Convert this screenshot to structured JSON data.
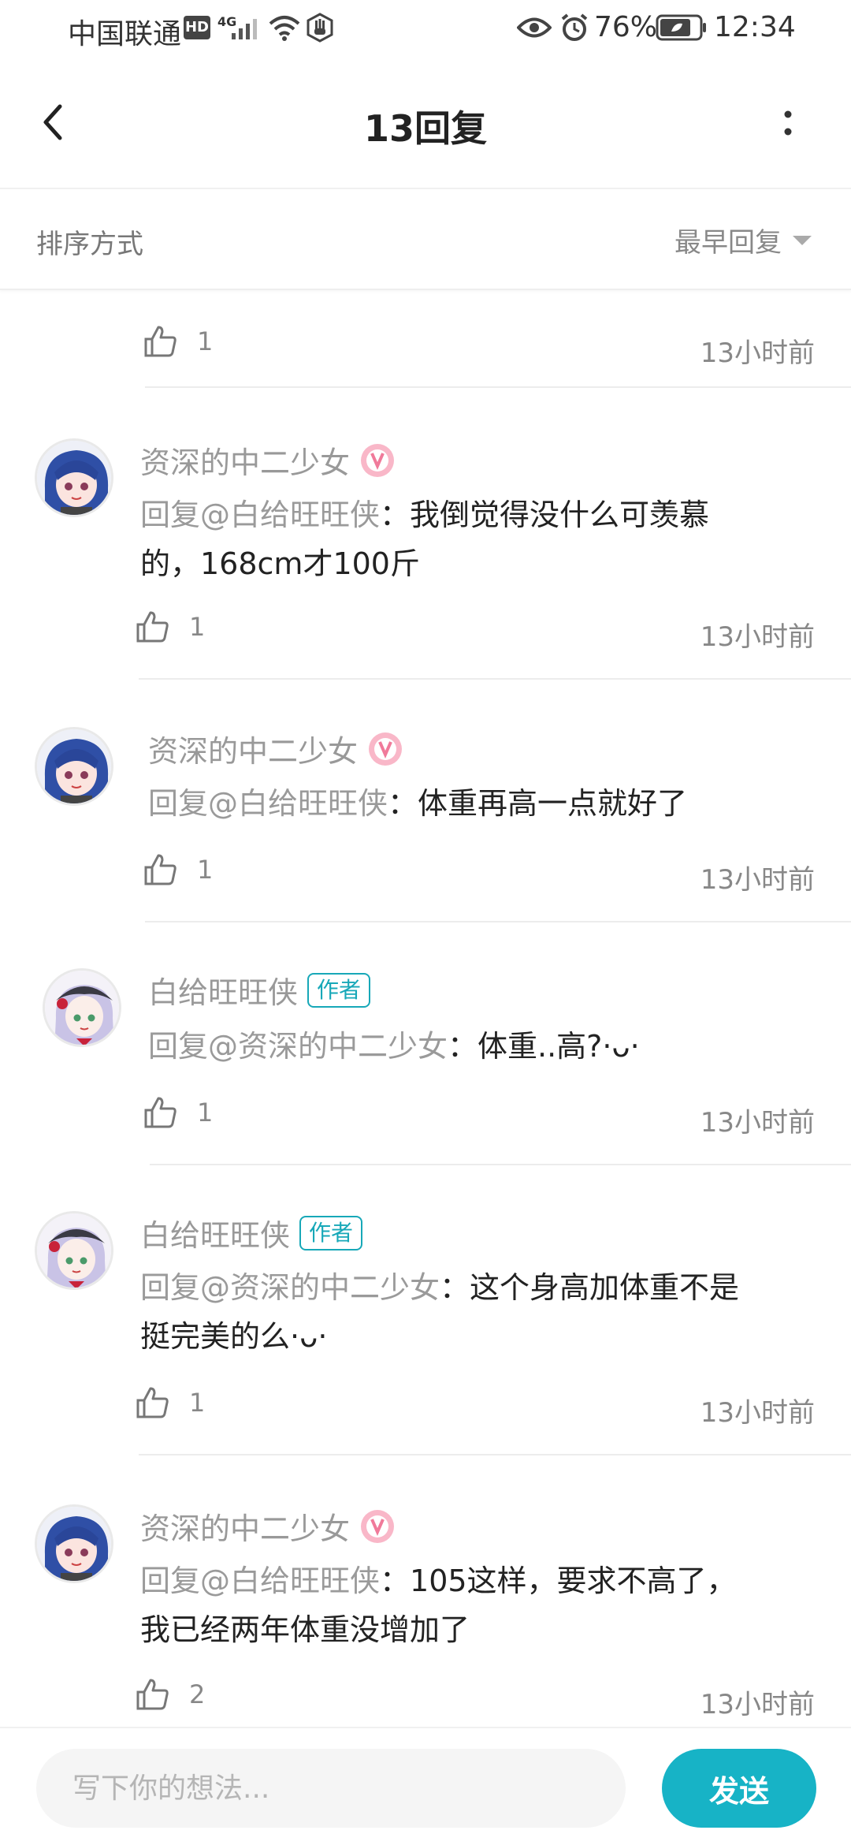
{
  "status_bar": {
    "carrier": "中国联通",
    "hd": "HD",
    "network": "4G",
    "battery": "76%",
    "time": "12:34"
  },
  "header": {
    "title": "13回复"
  },
  "sort": {
    "label": "排序方式",
    "selected": "最早回复"
  },
  "top_row": {
    "likes": "1",
    "time": "13小时前"
  },
  "comments": [
    {
      "user": "资深的中二少女",
      "mention": "回复@白给旺旺侠",
      "text_line1": "：我倒觉得没什么可羡慕",
      "text_line2": "的，168cm才100斤",
      "likes": "1",
      "time": "13小时前"
    },
    {
      "user": "资深的中二少女",
      "mention": "回复@白给旺旺侠",
      "text_line1": "：体重再高一点就好了",
      "text_line2": "",
      "likes": "1",
      "time": "13小时前"
    },
    {
      "user": "白给旺旺侠",
      "author_tag": "作者",
      "mention": "回复@资深的中二少女",
      "text_line1": "：体重..高?·ᴗ·",
      "text_line2": "",
      "likes": "1",
      "time": "13小时前"
    },
    {
      "user": "白给旺旺侠",
      "author_tag": "作者",
      "mention": "回复@资深的中二少女",
      "text_line1": "：这个身高加体重不是",
      "text_line2": "挺完美的么·ᴗ·",
      "likes": "1",
      "time": "13小时前"
    },
    {
      "user": "资深的中二少女",
      "mention": "回复@白给旺旺侠",
      "text_line1": "：105这样，要求不高了，",
      "text_line2": "我已经两年体重没增加了",
      "likes": "2",
      "time": "13小时前"
    }
  ],
  "composer": {
    "placeholder": "写下你的想法...",
    "send_label": "发送"
  },
  "colors": {
    "accent": "#17b3c6",
    "author_tag": "#17a8b8"
  },
  "icons": [
    "back-arrow-icon",
    "more-vertical-icon",
    "caret-down-icon",
    "thumbs-up-icon",
    "medal-badge-icon"
  ]
}
